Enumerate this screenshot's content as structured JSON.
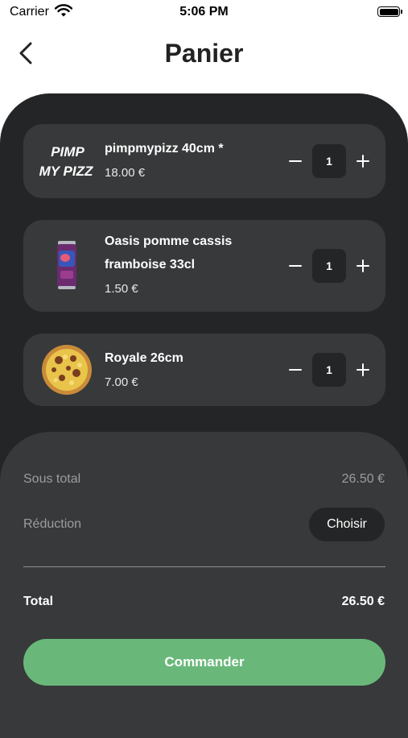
{
  "status_bar": {
    "carrier": "Carrier",
    "time": "5:06 PM"
  },
  "header": {
    "title": "Panier"
  },
  "cart": {
    "items": [
      {
        "name": "pimpmypizz 40cm *",
        "price": "18.00 €",
        "quantity": "1",
        "logo_text": "PIMP MY PIZZ"
      },
      {
        "name": "Oasis pomme cassis framboise 33cl",
        "price": "1.50 €",
        "quantity": "1"
      },
      {
        "name": "Royale 26cm",
        "price": "7.00 €",
        "quantity": "1"
      }
    ]
  },
  "summary": {
    "subtotal_label": "Sous total",
    "subtotal_value": "26.50 €",
    "discount_label": "Réduction",
    "choose_label": "Choisir",
    "total_label": "Total",
    "total_value": "26.50 €",
    "order_label": "Commander"
  },
  "colors": {
    "panel": "#232526",
    "card": "#37393a",
    "accent": "#69b87a"
  }
}
